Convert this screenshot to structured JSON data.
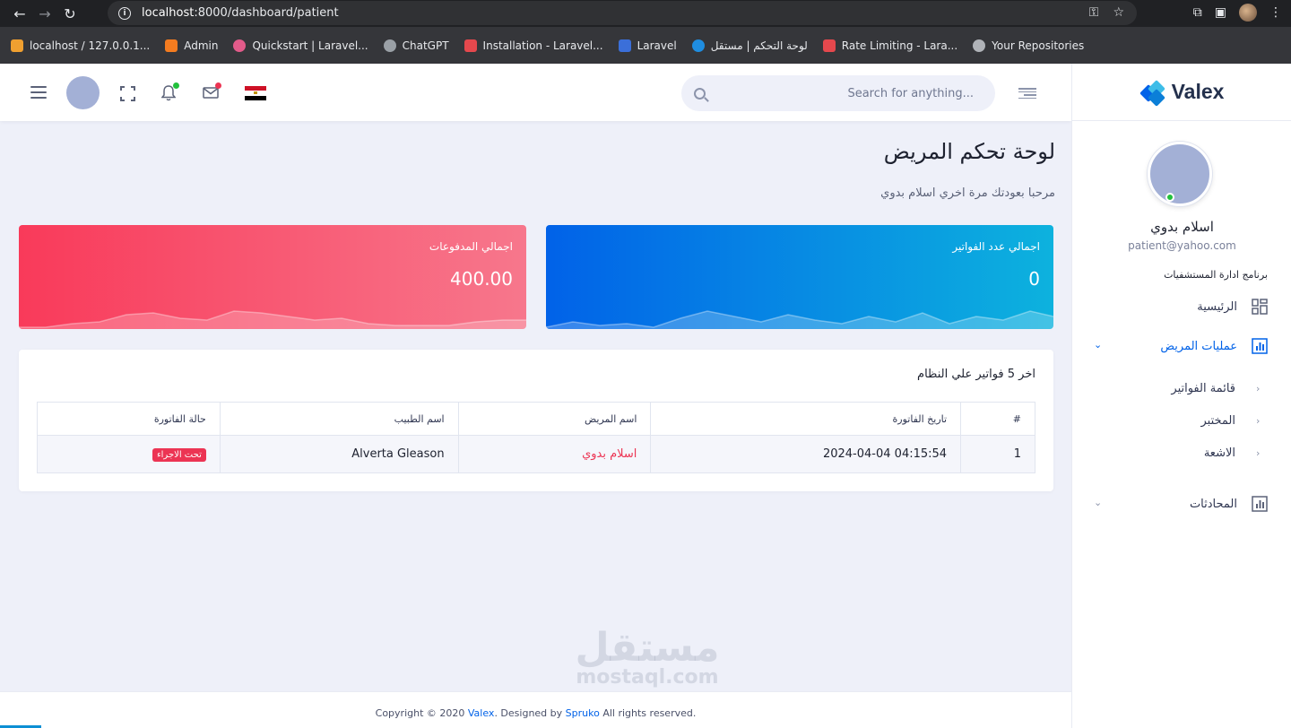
{
  "browser": {
    "url_host": "localhost",
    "url_path": ":8000/dashboard/patient",
    "bookmarks": [
      {
        "label": "localhost / 127.0.0.1...",
        "color": "#f0a030"
      },
      {
        "label": "Admin",
        "color": "#f47c20"
      },
      {
        "label": "Quickstart | Laravel...",
        "color": "#e25b8a"
      },
      {
        "label": "ChatGPT",
        "color": "#9aa0a6"
      },
      {
        "label": "Installation - Laravel...",
        "color": "#e5484d"
      },
      {
        "label": "Laravel",
        "color": "#3b6fd9"
      },
      {
        "label": "لوحة التحكم | مستقل",
        "color": "#1f8de0"
      },
      {
        "label": "Rate Limiting - Lara...",
        "color": "#e5484d"
      },
      {
        "label": "Your Repositories",
        "color": "#b0b3b8"
      }
    ]
  },
  "header": {
    "search_placeholder": "Search for anything...",
    "notification_dot_color": "#22c03c",
    "mail_dot_color": "#ec3453"
  },
  "sidebar": {
    "brand": "Valex",
    "user_name": "اسلام بدوي",
    "user_email": "patient@yahoo.com",
    "section_title": "برنامج ادارة المستشفيات",
    "items": [
      {
        "label": "الرئيسية",
        "icon": "grid-icon"
      },
      {
        "label": "عمليات المريض",
        "icon": "bar-chart-icon",
        "active": true,
        "expanded": true
      },
      {
        "label": "المحادثات",
        "icon": "bar-chart-icon"
      }
    ],
    "sub_items": [
      "قائمة الفواتير",
      "المختبر",
      "الاشعة"
    ],
    "accent_color": "#0162e8"
  },
  "page": {
    "title": "لوحة تحكم المريض",
    "subtitle": "مرحبا بعودتك مرة اخري اسلام بدوي"
  },
  "cards": [
    {
      "label": "اجمالي عدد الفواتير",
      "value": "0",
      "colors": [
        "#0162e8",
        "#0db2de"
      ]
    },
    {
      "label": "اجمالي المدفوعات",
      "value": "400.00",
      "colors": [
        "#f93a5a",
        "#f7778c"
      ]
    }
  ],
  "invoices": {
    "title": "اخر 5 فواتير علي النظام",
    "columns": [
      "#",
      "تاريخ الفاتورة",
      "اسم المريض",
      "اسم الطبيب",
      "حالة الفاتورة"
    ],
    "rows": [
      {
        "num": "1",
        "date": "04:15:54 2024-04-04",
        "patient": "اسلام بدوي",
        "doctor": "Alverta Gleason",
        "status": "تحت الاجراء"
      }
    ]
  },
  "footer": {
    "prefix": "Copyright © 2020 ",
    "brand": "Valex",
    "middle": ". Designed by ",
    "designer": "Spruko",
    "suffix": " All rights reserved."
  },
  "watermark": {
    "line1": "مستقل",
    "line2": "mostaql.com"
  }
}
